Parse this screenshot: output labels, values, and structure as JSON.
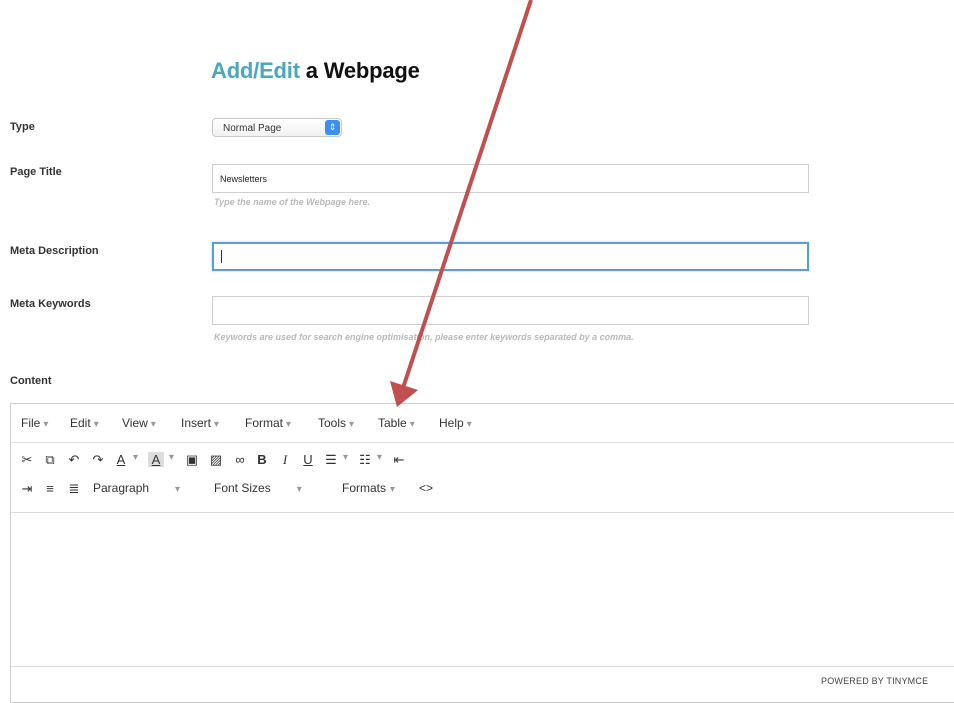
{
  "caption": "",
  "page_title": {
    "accent": "Add/Edit",
    "rest": "a Webpage"
  },
  "fields": {
    "type": {
      "label": "Type",
      "value": "Normal Page"
    },
    "page_title": {
      "label": "Page Title",
      "value": "Newsletters",
      "hint": "Type the name of the Webpage here."
    },
    "meta_description": {
      "label": "Meta Description",
      "value": ""
    },
    "meta_keywords": {
      "label": "Meta Keywords",
      "value": "",
      "hint": "Keywords are used for search engine optimisation, please enter keywords separated by a comma."
    },
    "content": {
      "label": "Content"
    }
  },
  "menubar": [
    "File",
    "Edit",
    "View",
    "Insert",
    "Format",
    "Tools",
    "Table",
    "Help"
  ],
  "toolbar2": {
    "paragraph": "Paragraph",
    "font_sizes": "Font Sizes",
    "formats": "Formats"
  },
  "status": {
    "powered": "POWERED BY TINYMCE"
  },
  "colors": {
    "accent": "#4aa8bb",
    "arrow": "#c0504d",
    "focus": "#5b9dd9"
  },
  "icons": [
    "cut-icon",
    "copy-icon",
    "undo-icon",
    "redo-icon",
    "text-color-icon",
    "background-color-icon",
    "media-icon",
    "image-icon",
    "link-icon",
    "bold-icon",
    "italic-icon",
    "underline-icon",
    "bullet-list-icon",
    "numbered-list-icon",
    "indent-icon",
    "outdent-icon",
    "align-left-icon",
    "align-center-icon",
    "source-code-icon"
  ]
}
